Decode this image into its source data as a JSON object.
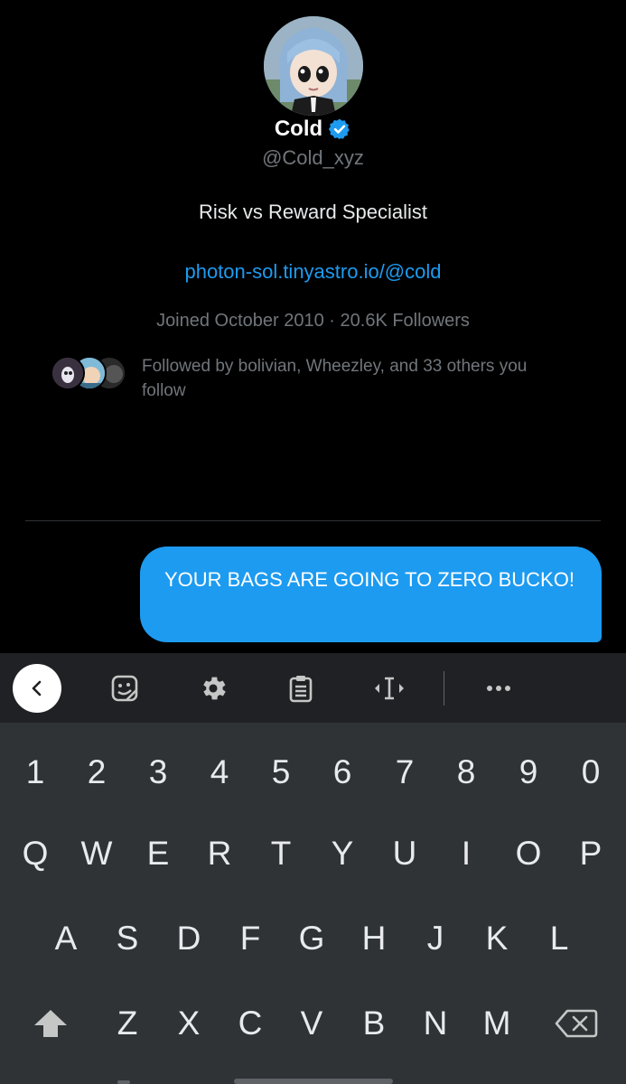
{
  "profile": {
    "name": "Cold",
    "handle": "@Cold_xyz",
    "bio": "Risk vs Reward Specialist",
    "link": "photon-sol.tinyastro.io/@cold",
    "meta": "Joined October 2010 · 20.6K Followers",
    "followed_by": "Followed by bolivian, Wheezley, and 33 others you follow"
  },
  "message": {
    "text": "YOUR BAGS ARE GOING TO ZERO BUCKO!"
  },
  "keyboard": {
    "toolbar": [
      "back-icon",
      "sticker-icon",
      "settings-icon",
      "clipboard-icon",
      "cursor-control-icon",
      "more-icon"
    ],
    "rows": [
      [
        "1",
        "2",
        "3",
        "4",
        "5",
        "6",
        "7",
        "8",
        "9",
        "0"
      ],
      [
        "Q",
        "W",
        "E",
        "R",
        "T",
        "Y",
        "U",
        "I",
        "O",
        "P"
      ],
      [
        "A",
        "S",
        "D",
        "F",
        "G",
        "H",
        "J",
        "K",
        "L"
      ],
      [
        "Z",
        "X",
        "C",
        "V",
        "B",
        "N",
        "M"
      ]
    ]
  },
  "colors": {
    "accent": "#1d9bf0",
    "background": "#000000",
    "muted_text": "#71767b",
    "keyboard_bg": "#2f3336",
    "toolbar_bg": "#202124"
  }
}
